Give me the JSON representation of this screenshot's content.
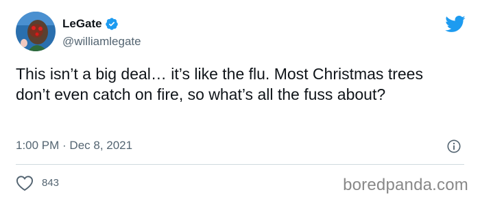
{
  "author": {
    "display_name": "LeGate",
    "handle": "@williamlegate",
    "verified": true,
    "avatar_icon": "profile-photo-avatar"
  },
  "tweet": {
    "text": "This isn’t a big deal… it’s like the flu. Most Christmas trees don’t even catch on fire, so what’s all the fuss about?",
    "timestamp": "1:00 PM · Dec 8, 2021"
  },
  "engagement": {
    "likes": "843"
  },
  "icons": {
    "brand": "twitter-bird-icon",
    "verified": "verified-badge-icon",
    "info": "info-icon",
    "like": "heart-icon"
  },
  "watermark": "boredpanda.com",
  "colors": {
    "accent": "#1d9bf0",
    "text_primary": "#0f1419",
    "text_secondary": "#536471",
    "divider": "#cfd9de"
  }
}
